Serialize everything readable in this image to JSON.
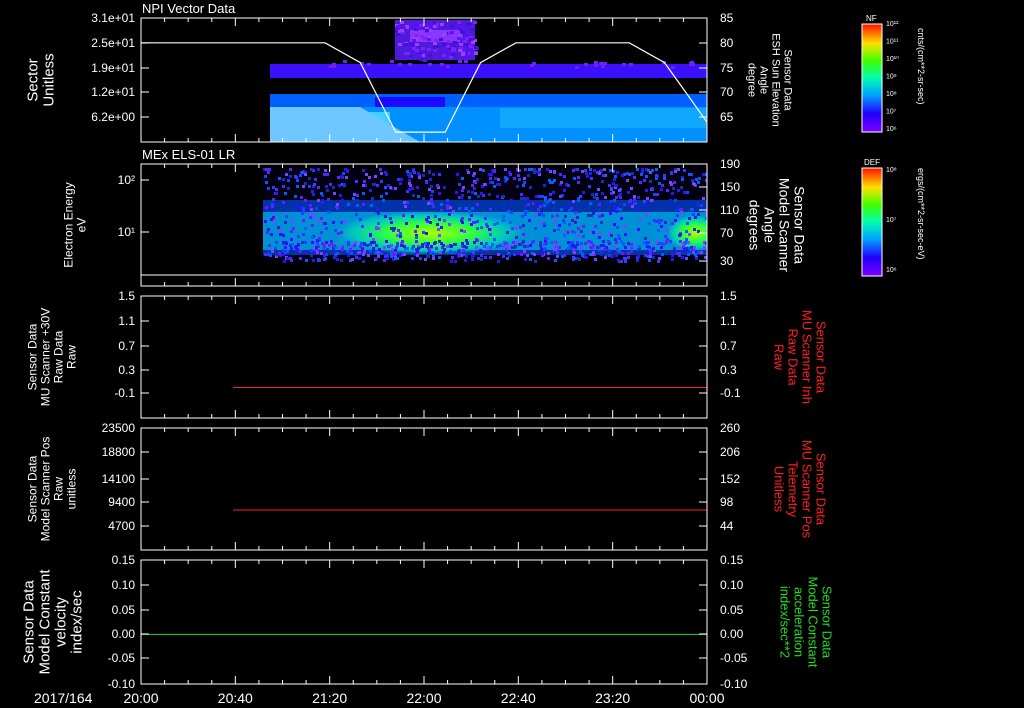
{
  "page": {
    "date_label": "2017/164"
  },
  "colors": {
    "bg": "#000000",
    "axis": "#ffffff",
    "red": "#ff2020",
    "green": "#22dd22"
  },
  "time_axis": {
    "ticks": [
      "20:00",
      "20:40",
      "21:20",
      "22:00",
      "22:40",
      "23:20",
      "00:00"
    ]
  },
  "chart_data": [
    {
      "type": "heatmap",
      "panel": "npi",
      "title": "NPI Vector Data",
      "ylabel_left": [
        "Sector",
        "Unitless"
      ],
      "yticks_left": [
        "3.1e+01",
        "2.5e+01",
        "1.9e+01",
        "1.2e+01",
        "6.2e+00"
      ],
      "ylabel_right": [
        "Sensor Data",
        "ESH Sun Elevation",
        "Angle",
        "degree"
      ],
      "yticks_right": [
        "85",
        "80",
        "75",
        "70",
        "65"
      ],
      "ylim_right": [
        60,
        85
      ],
      "overlay_line": {
        "color": "white",
        "x_hours": [
          20.0,
          21.3,
          21.55,
          21.8,
          22.15,
          22.4,
          22.65,
          23.45,
          23.7,
          23.85,
          24.0
        ],
        "y": [
          80,
          80,
          76,
          62,
          62,
          76,
          80,
          80,
          76,
          70,
          64
        ]
      },
      "colorbar": {
        "label": "cnts/(cm**2-sr-sec)",
        "tag": "NF",
        "ticks": [
          "10¹²",
          "10¹¹",
          "10¹⁰",
          "10⁹",
          "10⁸",
          "10⁷",
          "10⁶"
        ]
      }
    },
    {
      "type": "heatmap",
      "panel": "els",
      "title": "MEx ELS-01 LR",
      "ylabel_left": [
        "Electron Energy",
        "eV"
      ],
      "yticks_left": [
        "10²",
        "10¹"
      ],
      "ylabel_right": [
        "Sensor Data",
        "Model Scanner",
        "Angle",
        "degrees"
      ],
      "yticks_right": [
        "190",
        "150",
        "110",
        "70",
        "30"
      ],
      "ylim_right": [
        0,
        190
      ],
      "overlay_line": {
        "color": "white",
        "x_hours": [
          20.0,
          24.0
        ],
        "y": [
          0,
          0
        ]
      },
      "colorbar": {
        "label": "ergs/(cm**2-sr-sec-eV)",
        "tag": "DEF",
        "ticks": [
          "10⁸",
          "10⁷",
          "10⁶"
        ]
      }
    },
    {
      "type": "line",
      "panel": "p3",
      "ylabel_left": [
        "Sensor Data",
        "MU Scanner +30V",
        "Raw Data",
        "Raw"
      ],
      "yticks_left": [
        "1.5",
        "1.1",
        "0.7",
        "0.3",
        "-0.1"
      ],
      "ylabel_right": [
        "Sensor Data",
        "MU Scanner Inh",
        "Raw Data",
        "Raw"
      ],
      "yticks_right": [
        "1.5",
        "1.1",
        "0.7",
        "0.3",
        "-0.1"
      ],
      "ylim": [
        -0.5,
        1.5
      ],
      "series": [
        {
          "color": "red",
          "x_hours": [
            20.65,
            24.0
          ],
          "y": [
            0.0,
            0.0
          ]
        }
      ]
    },
    {
      "type": "line",
      "panel": "p4",
      "ylabel_left": [
        "Sensor Data",
        "Model Scanner Pos",
        "Raw",
        "unitless"
      ],
      "yticks_left": [
        "23500",
        "18800",
        "14100",
        "9400",
        "4700"
      ],
      "ylabel_right": [
        "Sensor Data",
        "MU Scanner Pos",
        "Telemetry",
        "Unitless"
      ],
      "yticks_right": [
        "260",
        "206",
        "152",
        "98",
        "44"
      ],
      "ylim": [
        0,
        23500
      ],
      "series": [
        {
          "color": "red",
          "x_hours": [
            20.65,
            24.0
          ],
          "y": [
            7700,
            7700
          ]
        }
      ]
    },
    {
      "type": "line",
      "panel": "p5",
      "ylabel_left": [
        "Sensor Data",
        "Model Constant",
        "velocity",
        "index/sec"
      ],
      "yticks_left": [
        "0.15",
        "0.10",
        "0.05",
        "0.00",
        "-0.05",
        "-0.10"
      ],
      "ylabel_right": [
        "Sensor Data",
        "Model Constant",
        "acceleration",
        "index/sec**2"
      ],
      "yticks_right": [
        "0.15",
        "0.10",
        "0.05",
        "0.00",
        "-0.05",
        "-0.10"
      ],
      "ylim": [
        -0.1,
        0.15
      ],
      "series": [
        {
          "color": "green",
          "x_hours": [
            20.0,
            24.0
          ],
          "y": [
            0.0,
            0.0
          ]
        }
      ]
    }
  ]
}
